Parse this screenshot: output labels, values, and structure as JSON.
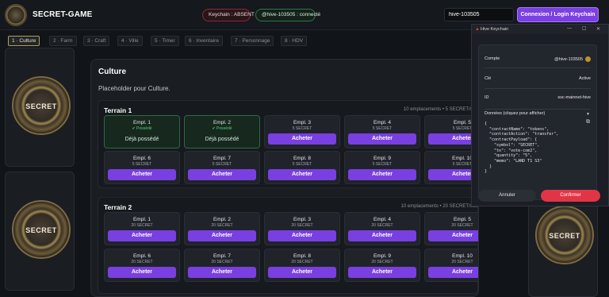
{
  "header": {
    "title": "SECRET-GAME",
    "keychain_status": "Keychain : ABSENT",
    "connected_status": "@hive-103505 : connecté",
    "username_value": "hive-103505",
    "login_label": "Connexion / Login Keychain",
    "colors": {
      "accent": "#7b3fe4",
      "absent": "#8a2a33",
      "connected": "#2a7a47"
    }
  },
  "tabs": [
    {
      "label": "1 · Culture",
      "active": true
    },
    {
      "label": "2 · Farm",
      "active": false
    },
    {
      "label": "3 · Craft",
      "active": false
    },
    {
      "label": "4 · Ville",
      "active": false
    },
    {
      "label": "5 · Timer",
      "active": false
    },
    {
      "label": "6 · Inventaire",
      "active": false
    },
    {
      "label": "7 · Personnage",
      "active": false
    },
    {
      "label": "8 · HDV",
      "active": false
    }
  ],
  "sidebar": {
    "coin_label": "SECRET"
  },
  "main": {
    "title": "Culture",
    "placeholder": "Placeholder pour Culture.",
    "terrains": [
      {
        "title": "Terrain 1",
        "meta": "10 emplacements • 5 SECRET/slot",
        "slots": [
          {
            "name": "Empl. 1",
            "sub": "✔ Possédé",
            "owned": true,
            "action": "Déjà possédé"
          },
          {
            "name": "Empl. 2",
            "sub": "✔ Possédé",
            "owned": true,
            "action": "Déjà possédé"
          },
          {
            "name": "Empl. 3",
            "sub": "5 SECRET",
            "owned": false,
            "action": "Acheter"
          },
          {
            "name": "Empl. 4",
            "sub": "5 SECRET",
            "owned": false,
            "action": "Acheter"
          },
          {
            "name": "Empl. 5",
            "sub": "5 SECRET",
            "owned": false,
            "action": "Acheter"
          },
          {
            "name": "Empl. 6",
            "sub": "5 SECRET",
            "owned": false,
            "action": "Acheter"
          },
          {
            "name": "Empl. 7",
            "sub": "5 SECRET",
            "owned": false,
            "action": "Acheter"
          },
          {
            "name": "Empl. 8",
            "sub": "5 SECRET",
            "owned": false,
            "action": "Acheter"
          },
          {
            "name": "Empl. 9",
            "sub": "5 SECRET",
            "owned": false,
            "action": "Acheter"
          },
          {
            "name": "Empl. 10",
            "sub": "5 SECRET",
            "owned": false,
            "action": "Acheter"
          }
        ]
      },
      {
        "title": "Terrain 2",
        "meta": "10 emplacements • 20 SECRET/slot",
        "slots": [
          {
            "name": "Empl. 1",
            "sub": "20 SECRET",
            "owned": false,
            "action": "Acheter"
          },
          {
            "name": "Empl. 2",
            "sub": "20 SECRET",
            "owned": false,
            "action": "Acheter"
          },
          {
            "name": "Empl. 3",
            "sub": "20 SECRET",
            "owned": false,
            "action": "Acheter"
          },
          {
            "name": "Empl. 4",
            "sub": "20 SECRET",
            "owned": false,
            "action": "Acheter"
          },
          {
            "name": "Empl. 5",
            "sub": "20 SECRET",
            "owned": false,
            "action": "Acheter"
          },
          {
            "name": "Empl. 6",
            "sub": "20 SECRET",
            "owned": false,
            "action": "Acheter"
          },
          {
            "name": "Empl. 7",
            "sub": "20 SECRET",
            "owned": false,
            "action": "Acheter"
          },
          {
            "name": "Empl. 8",
            "sub": "20 SECRET",
            "owned": false,
            "action": "Acheter"
          },
          {
            "name": "Empl. 9",
            "sub": "20 SECRET",
            "owned": false,
            "action": "Acheter"
          },
          {
            "name": "Empl. 10",
            "sub": "20 SECRET",
            "owned": false,
            "action": "Acheter"
          }
        ]
      }
    ]
  },
  "keychain": {
    "window_title": "Hive Keychain",
    "account_label": "Compte",
    "account_value": "@hive-103505",
    "key_label": "Clé",
    "key_value": "Active",
    "id_label": "ID",
    "id_value": "ssc-mainnet-hive",
    "data_label": "Données (cliquez pour afficher)",
    "data_json": "{\n  \"contractName\": \"tokens\",\n  \"contractAction\": \"transfer\",\n  \"contractPayload\": {\n    \"symbol\": \"SECRET\",\n    \"to\": \"vote-com2\",\n    \"quantity\": \"5\",\n    \"memo\": \"LAND T1 S3\"\n  }\n}",
    "cancel_label": "Annuler",
    "confirm_label": "Confirmer",
    "colors": {
      "confirm": "#e03546"
    }
  }
}
